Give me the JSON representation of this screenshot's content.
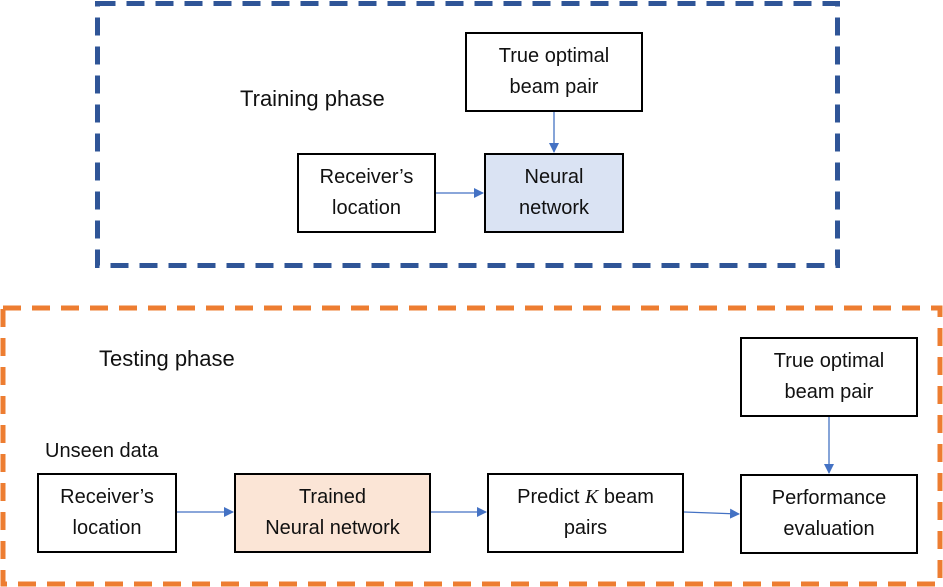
{
  "colors": {
    "training_frame": "#2f5597",
    "testing_frame": "#ed7d31",
    "arrow": "#4472c4",
    "neural_network_fill": "#dae3f3",
    "trained_network_fill": "#fbe5d6"
  },
  "training": {
    "title": "Training phase",
    "true_optimal": {
      "line1": "True optimal",
      "line2": "beam pair"
    },
    "receiver": {
      "line1": "Receiver’s",
      "line2": "location"
    },
    "neural_network": {
      "line1": "Neural",
      "line2": "network"
    }
  },
  "testing": {
    "title": "Testing phase",
    "unseen_label": "Unseen data",
    "receiver": {
      "line1": "Receiver’s",
      "line2": "location"
    },
    "trained_network": {
      "line1": "Trained",
      "line2": "Neural network"
    },
    "predict": {
      "line1_pre": "Predict ",
      "line1_var": "K",
      "line1_post": " beam",
      "line2": "pairs"
    },
    "performance": {
      "line1": "Performance",
      "line2": "evaluation"
    },
    "true_optimal": {
      "line1": "True optimal",
      "line2": "beam pair"
    }
  }
}
